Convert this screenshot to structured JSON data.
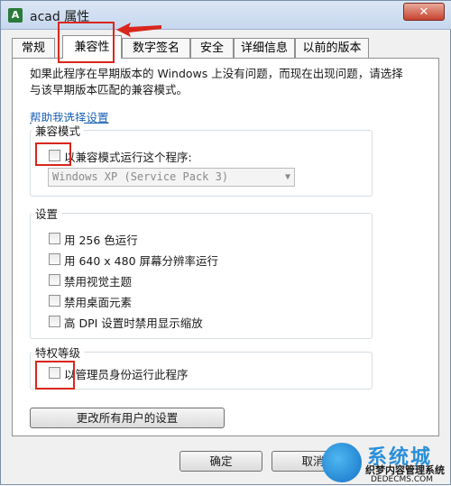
{
  "window": {
    "title": "acad 属性",
    "close_label": "✕"
  },
  "tabs": [
    {
      "label": "常规"
    },
    {
      "label": "兼容性"
    },
    {
      "label": "数字签名"
    },
    {
      "label": "安全"
    },
    {
      "label": "详细信息"
    },
    {
      "label": "以前的版本"
    }
  ],
  "intro_text": "如果此程序在早期版本的 Windows 上没有问题，而现在出现问题，请选择与该早期版本匹配的兼容模式。",
  "help_link": "帮助我选择设置",
  "compat_group": {
    "title": "兼容模式",
    "checkbox_label": "以兼容模式运行这个程序:",
    "dropdown_value": "Windows XP (Service Pack 3)"
  },
  "settings_group": {
    "title": "设置",
    "items": [
      {
        "label": "用 256 色运行"
      },
      {
        "label": "用 640 x 480 屏幕分辨率运行"
      },
      {
        "label": "禁用视觉主题"
      },
      {
        "label": "禁用桌面元素"
      },
      {
        "label": "高 DPI 设置时禁用显示缩放"
      }
    ]
  },
  "privilege_group": {
    "title": "特权等级",
    "checkbox_label": "以管理员身份运行此程序"
  },
  "buttons": {
    "change_all": "更改所有用户的设置",
    "ok": "确定",
    "cancel": "取消"
  },
  "watermark": {
    "top": "系统城",
    "mid": "织梦内容管理系统",
    "bot": "DEDECMS.COM"
  },
  "accent_colors": {
    "highlight": "#d9261c",
    "link": "#1a5fb4"
  }
}
